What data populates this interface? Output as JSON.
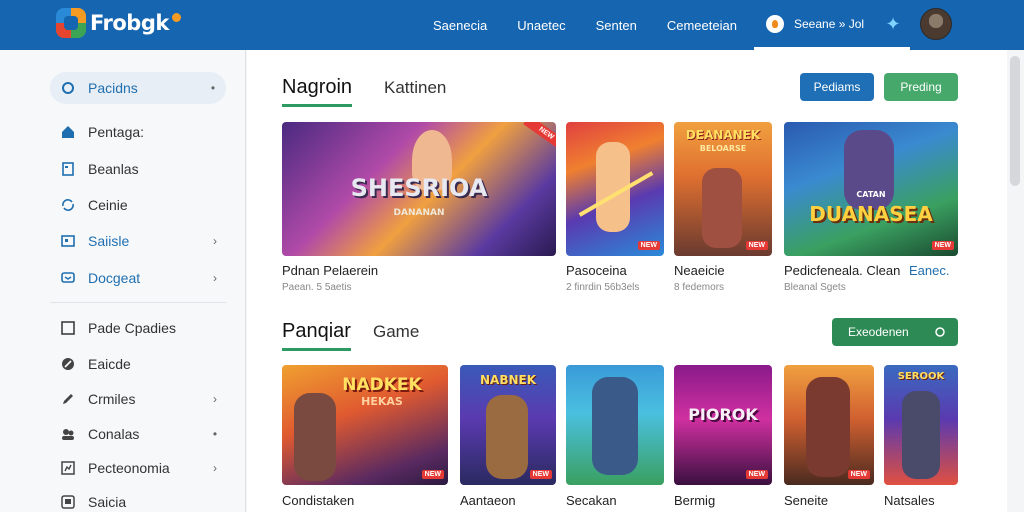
{
  "app": {
    "logo_text": "Frobgk",
    "nav": [
      "Saenecia",
      "Unaetec",
      "Senten",
      "Cemeeteian"
    ],
    "user_label": "Seeane » Jol",
    "icons": {
      "user": "user-pin-icon",
      "settings": "gear-icon"
    }
  },
  "sidebar": {
    "items": [
      {
        "label": "Pacidns",
        "icon": "circle-icon",
        "arrow": "•"
      },
      {
        "label": "Pentaga:",
        "icon": "home-icon",
        "arrow": ""
      },
      {
        "label": "Beanlas",
        "icon": "square-outline-icon",
        "arrow": ""
      },
      {
        "label": "Ceinie",
        "icon": "sync-icon",
        "arrow": ""
      },
      {
        "label": "Saiisle",
        "icon": "square-icon",
        "arrow": "›"
      },
      {
        "label": "Docgeat",
        "icon": "chat-icon",
        "arrow": "›"
      },
      {
        "label": "Pade Cpadies",
        "icon": "checkbox-icon",
        "arrow": ""
      },
      {
        "label": "Eaicde",
        "icon": "compass-icon",
        "arrow": ""
      },
      {
        "label": "Crmiles",
        "icon": "pencil-icon",
        "arrow": "›"
      },
      {
        "label": "Conalas",
        "icon": "group-icon",
        "arrow": "•"
      },
      {
        "label": "Pecteonomia",
        "icon": "chart-icon",
        "arrow": "›"
      },
      {
        "label": "Saicia",
        "icon": "box-icon",
        "arrow": ""
      }
    ]
  },
  "section1": {
    "title": "Nagroin",
    "tab": "Kattinen",
    "btn_primary": "Pediams",
    "btn_secondary": "Preding",
    "cards": [
      {
        "title": "Pdnan Pelaerein",
        "sub": "Paean. 5 5aetis",
        "art": "SHESRIOA",
        "art_sub": "DANANAN",
        "banner": "NEW"
      },
      {
        "title": "Pasoceina",
        "sub": "2 finrdin 56b3els",
        "art": "",
        "tag": "NEW"
      },
      {
        "title": "Neaeicie",
        "sub": "8 fedemors",
        "art": "DEANANEK",
        "art_sub": "BELOARSE",
        "tag": "NEW"
      },
      {
        "title": "Pedicfeneala. Clean",
        "sub": "Bleanal Sgets",
        "extra": "Eanec.",
        "art": "DUANASEA",
        "art_sub": "CATAN",
        "tag": "NEW"
      }
    ]
  },
  "section2": {
    "title": "Panqiar",
    "tab": "Game",
    "btn": "Exeodenen",
    "cards": [
      {
        "title": "Condistaken",
        "art": "NADKEK",
        "art_sub": "HEKAS",
        "tag": "NEW"
      },
      {
        "title": "Aantaeon",
        "art": "NABNEK",
        "art_sub": "",
        "tag": "NEW"
      },
      {
        "title": "Secakan",
        "art": "",
        "tag": ""
      },
      {
        "title": "Bermig",
        "art": "PIOROK",
        "art_sub": "",
        "tag": "NEW"
      },
      {
        "title": "Seneite",
        "art": "",
        "tag": "NEW"
      },
      {
        "title": "Natsales",
        "art": "SEROOK",
        "art_sub": "",
        "tag": ""
      }
    ]
  },
  "colors": {
    "topbar": "#1565b0",
    "primary_button": "#1e6fb5",
    "secondary_button": "#46a86a",
    "green_button": "#2e8a55",
    "accent_underline": "#2d9a62"
  }
}
